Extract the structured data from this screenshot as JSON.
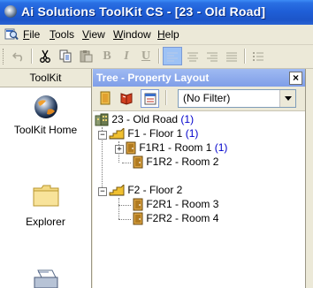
{
  "window": {
    "title": "Ai Solutions ToolKit CS - [23 - Old Road]"
  },
  "menu": [
    {
      "label": "File",
      "u": "F",
      "rest": "ile"
    },
    {
      "label": "Tools",
      "u": "T",
      "rest": "ools"
    },
    {
      "label": "View",
      "u": "V",
      "rest": "iew"
    },
    {
      "label": "Window",
      "u": "W",
      "rest": "indow"
    },
    {
      "label": "Help",
      "u": "H",
      "rest": "elp"
    }
  ],
  "toolbar": {
    "bold": "B",
    "italic": "I",
    "underline": "U"
  },
  "leftnav": {
    "header": "ToolKit",
    "items": [
      {
        "label": "ToolKit Home",
        "icon": "globe-icon"
      },
      {
        "label": "Explorer",
        "icon": "folder-icon"
      },
      {
        "label": "",
        "icon": "printer-icon"
      }
    ]
  },
  "tree_panel": {
    "title": "Tree - Property Layout",
    "close": "×",
    "filter": {
      "value": "(No Filter)"
    },
    "nodes": [
      {
        "label": "23 - Old Road",
        "count": "(1)"
      },
      {
        "label": "F1 - Floor 1",
        "count": "(1)"
      },
      {
        "label": "F1R1 - Room 1",
        "count": "(1)"
      },
      {
        "label": "F1R2 - Room 2",
        "count": ""
      },
      {
        "label": "F2 - Floor 2",
        "count": ""
      },
      {
        "label": "F2R1 - Room 3",
        "count": ""
      },
      {
        "label": "F2R2 - Room 4",
        "count": ""
      }
    ]
  },
  "colors": {
    "titlebar": "#1f5fd7",
    "tree_header": "#8aa8ec",
    "highlight": "#9dc2f5",
    "count_blue": "#0000cc"
  }
}
